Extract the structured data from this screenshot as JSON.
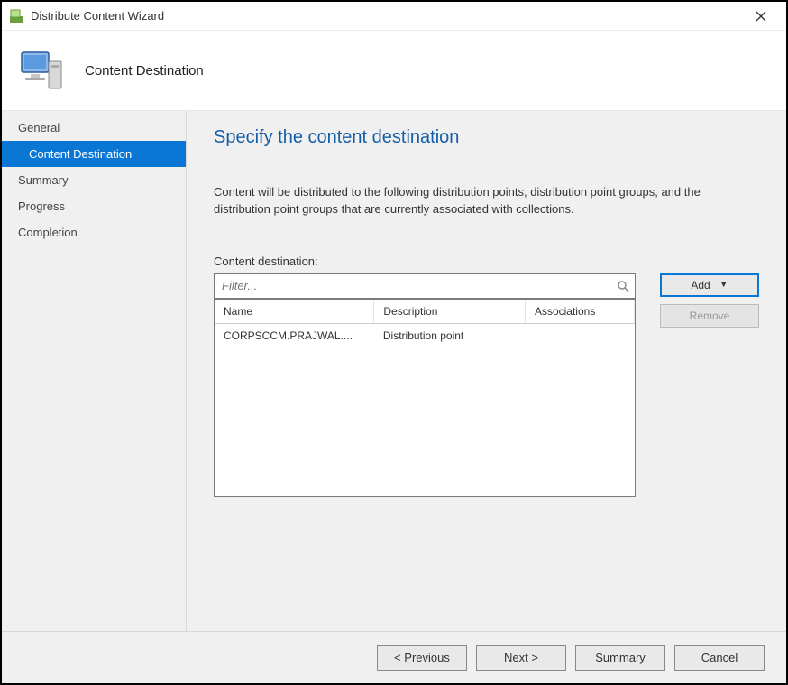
{
  "window": {
    "title": "Distribute Content Wizard"
  },
  "header": {
    "page_title": "Content Destination"
  },
  "sidebar": {
    "items": [
      {
        "label": "General"
      },
      {
        "label": "Content Destination"
      },
      {
        "label": "Summary"
      },
      {
        "label": "Progress"
      },
      {
        "label": "Completion"
      }
    ],
    "active_index": 1
  },
  "main": {
    "heading": "Specify the content destination",
    "description": "Content will be distributed to the following distribution points, distribution point groups, and the distribution point groups that are currently associated with collections.",
    "list_label": "Content destination:",
    "filter_placeholder": "Filter...",
    "add_label": "Add",
    "remove_label": "Remove",
    "columns": {
      "name": "Name",
      "description": "Description",
      "associations": "Associations"
    },
    "rows": [
      {
        "name": "CORPSCCM.PRAJWAL....",
        "description": "Distribution point",
        "associations": ""
      }
    ]
  },
  "footer": {
    "previous": "< Previous",
    "next": "Next >",
    "summary": "Summary",
    "cancel": "Cancel"
  }
}
